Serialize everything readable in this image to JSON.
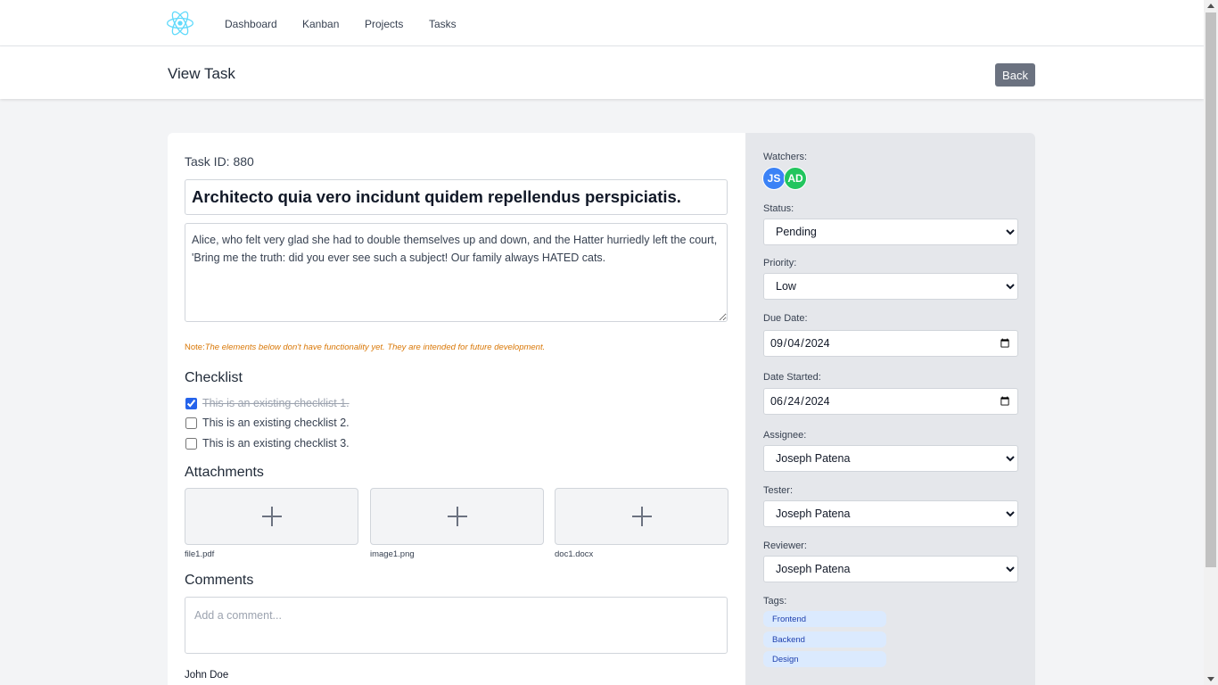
{
  "nav": {
    "logo_icon": "react-logo-icon",
    "items": [
      {
        "label": "Dashboard"
      },
      {
        "label": "Kanban"
      },
      {
        "label": "Projects"
      },
      {
        "label": "Tasks"
      }
    ]
  },
  "header": {
    "title": "View Task",
    "back_label": "Back"
  },
  "task": {
    "id_label": "Task ID: 880",
    "title": "Architecto quia vero incidunt quidem repellendus perspiciatis.",
    "description": "Alice, who felt very glad she had to double themselves up and down, and the Hatter hurriedly left the court, 'Bring me the truth: did you ever see such a subject! Our family always HATED cats.",
    "note_prefix": "Note:",
    "note_text": "The elements below don't have functionality yet. They are intended for future development."
  },
  "checklist": {
    "heading": "Checklist",
    "items": [
      {
        "label": "This is an existing checklist 1.",
        "checked": true
      },
      {
        "label": "This is an existing checklist 2.",
        "checked": false
      },
      {
        "label": "This is an existing checklist 3.",
        "checked": false
      }
    ]
  },
  "attachments": {
    "heading": "Attachments",
    "files": [
      {
        "name": "file1.pdf"
      },
      {
        "name": "image1.png"
      },
      {
        "name": "doc1.docx"
      }
    ]
  },
  "comments": {
    "heading": "Comments",
    "placeholder": "Add a comment...",
    "items": [
      {
        "author": "John Doe"
      }
    ]
  },
  "sidebar": {
    "watchers_label": "Watchers:",
    "watchers": [
      {
        "initials": "JS",
        "color": "#3b82f6"
      },
      {
        "initials": "AD",
        "color": "#22c55e"
      }
    ],
    "status_label": "Status:",
    "status_value": "Pending",
    "priority_label": "Priority:",
    "priority_value": "Low",
    "due_date_label": "Due Date:",
    "due_date_value": "2024-09-04",
    "date_started_label": "Date Started:",
    "date_started_value": "2024-06-24",
    "assignee_label": "Assignee:",
    "assignee_value": "Joseph Patena",
    "tester_label": "Tester:",
    "tester_value": "Joseph Patena",
    "reviewer_label": "Reviewer:",
    "reviewer_value": "Joseph Patena",
    "tags_label": "Tags:",
    "tags": [
      {
        "label": "Frontend"
      },
      {
        "label": "Backend"
      },
      {
        "label": "Design"
      }
    ]
  },
  "colors": {
    "accent": "#2563eb",
    "back_button": "#6b7280",
    "note": "#d97706",
    "tag_bg": "#dbeafe",
    "tag_text": "#1e40af"
  }
}
